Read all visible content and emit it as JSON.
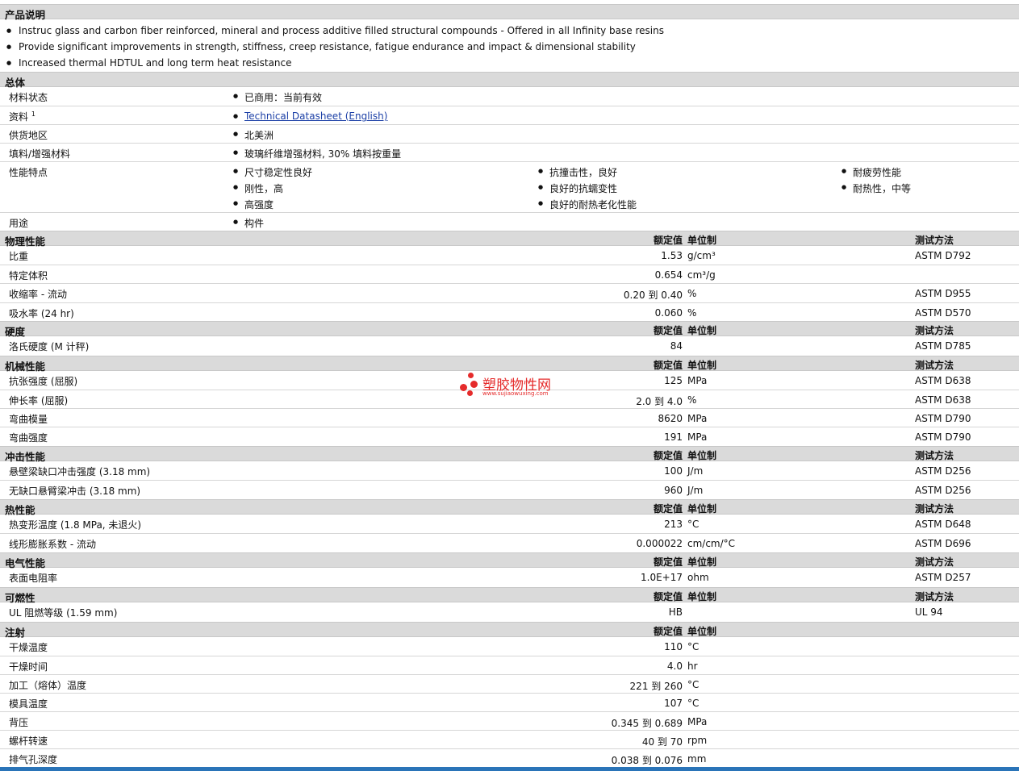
{
  "description": {
    "title": "产品说明",
    "bullets": [
      "Instruc glass and carbon fiber reinforced, mineral and process additive filled structural compounds - Offered in all Infinity base resins",
      "Provide significant improvements in strength, stiffness, creep resistance, fatigue endurance and impact & dimensional stability",
      "Increased thermal HDTUL and long term heat resistance"
    ]
  },
  "general": {
    "title": "总体",
    "status_label": "材料状态",
    "status_value": "已商用：当前有效",
    "docs_label": "资料",
    "docs_sup": "1",
    "docs_link": "Technical Datasheet (English)",
    "region_label": "供货地区",
    "region_value": "北美洲",
    "filler_label": "填料/增强材料",
    "filler_value": "玻璃纤维增强材料, 30% 填料按重量",
    "features_label": "性能特点",
    "features": [
      "尺寸稳定性良好",
      "刚性，高",
      "高强度",
      "抗撞击性，良好",
      "良好的抗蠕变性",
      "良好的耐热老化性能",
      "耐疲劳性能",
      "耐热性，中等"
    ],
    "uses_label": "用途",
    "uses_value": "构件"
  },
  "headers": {
    "nominal": "额定值",
    "unit": "单位制",
    "method": "测试方法"
  },
  "physical": {
    "title": "物理性能",
    "rows": [
      {
        "label": "比重",
        "value": "1.53",
        "unit": "g/cm³",
        "method": "ASTM D792"
      },
      {
        "label": "特定体积",
        "value": "0.654",
        "unit": "cm³/g",
        "method": ""
      },
      {
        "label": "收缩率 - 流动",
        "value": "0.20 到  0.40",
        "unit": "%",
        "method": "ASTM D955"
      },
      {
        "label": "吸水率 (24 hr)",
        "value": "0.060",
        "unit": "%",
        "method": "ASTM D570"
      }
    ]
  },
  "hardness": {
    "title": "硬度",
    "rows": [
      {
        "label": "洛氏硬度 (M 计秤)",
        "value": "84",
        "unit": "",
        "method": "ASTM D785"
      }
    ]
  },
  "mechanical": {
    "title": "机械性能",
    "rows": [
      {
        "label": "抗张强度 (屈服)",
        "value": "125",
        "unit": "MPa",
        "method": "ASTM D638"
      },
      {
        "label": "伸长率 (屈服)",
        "value": "2.0 到  4.0",
        "unit": "%",
        "method": "ASTM D638"
      },
      {
        "label": "弯曲模量",
        "value": "8620",
        "unit": "MPa",
        "method": "ASTM D790"
      },
      {
        "label": "弯曲强度",
        "value": "191",
        "unit": "MPa",
        "method": "ASTM D790"
      }
    ]
  },
  "impact": {
    "title": "冲击性能",
    "rows": [
      {
        "label": "悬壁梁缺口冲击强度 (3.18 mm)",
        "value": "100",
        "unit": "J/m",
        "method": "ASTM D256"
      },
      {
        "label": "无缺口悬臂梁冲击 (3.18 mm)",
        "value": "960",
        "unit": "J/m",
        "method": "ASTM D256"
      }
    ]
  },
  "thermal": {
    "title": "热性能",
    "rows": [
      {
        "label": "热变形温度 (1.8 MPa, 未退火)",
        "value": "213",
        "unit": "°C",
        "method": "ASTM D648"
      },
      {
        "label": "线形膨胀系数 - 流动",
        "value": "0.000022",
        "unit": "cm/cm/°C",
        "method": "ASTM D696"
      }
    ]
  },
  "electrical": {
    "title": "电气性能",
    "rows": [
      {
        "label": "表面电阻率",
        "value": "1.0E+17",
        "unit": "ohm",
        "method": "ASTM D257"
      }
    ]
  },
  "flammability": {
    "title": "可燃性",
    "rows": [
      {
        "label": "UL 阻燃等级 (1.59 mm)",
        "value": "HB",
        "unit": "",
        "method": "UL 94"
      }
    ]
  },
  "injection": {
    "title": "注射",
    "rows": [
      {
        "label": "干燥温度",
        "value": "110",
        "unit": "°C"
      },
      {
        "label": "干燥时间",
        "value": "4.0",
        "unit": "hr"
      },
      {
        "label": "加工（熔体）温度",
        "value": "221 到  260",
        "unit": "°C"
      },
      {
        "label": "模具温度",
        "value": "107",
        "unit": "°C"
      },
      {
        "label": "背压",
        "value": "0.345 到  0.689",
        "unit": "MPa"
      },
      {
        "label": "螺杆转速",
        "value": "40 到  70",
        "unit": "rpm"
      },
      {
        "label": "排气孔深度",
        "value": "0.038 到  0.076",
        "unit": "mm"
      }
    ]
  },
  "watermark": {
    "name": "塑胶物性网",
    "url": "www.sujiaowuxing.com"
  }
}
